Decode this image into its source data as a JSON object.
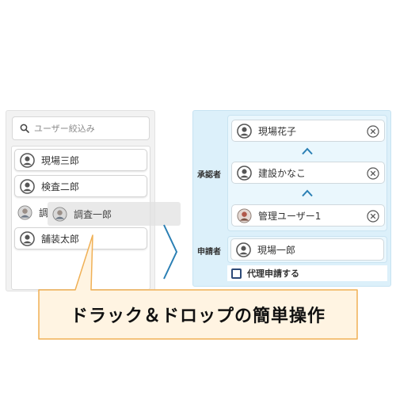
{
  "search": {
    "placeholder": "ユーザー絞込み"
  },
  "user_list": {
    "items": [
      {
        "label": "現場三郎"
      },
      {
        "label": "検査二郎"
      },
      {
        "label": "調"
      },
      {
        "label": "舗装太郎"
      }
    ]
  },
  "dragging": {
    "label": "調査一郎"
  },
  "approvers": {
    "label": "承認者",
    "items": [
      {
        "label": "現場花子"
      },
      {
        "label": "建設かなこ"
      },
      {
        "label": "管理ユーザー1"
      }
    ]
  },
  "applicant": {
    "label": "申請者",
    "value": "現場一郎"
  },
  "proxy": {
    "label": "代理申請する"
  },
  "callout": {
    "text": "ドラック＆ドロップの簡単操作"
  },
  "colors": {
    "accent": "#2a7fb4",
    "panel_bg": "#dcf0fa",
    "callout_bg": "#fff4e2",
    "callout_border": "#f0b055"
  }
}
